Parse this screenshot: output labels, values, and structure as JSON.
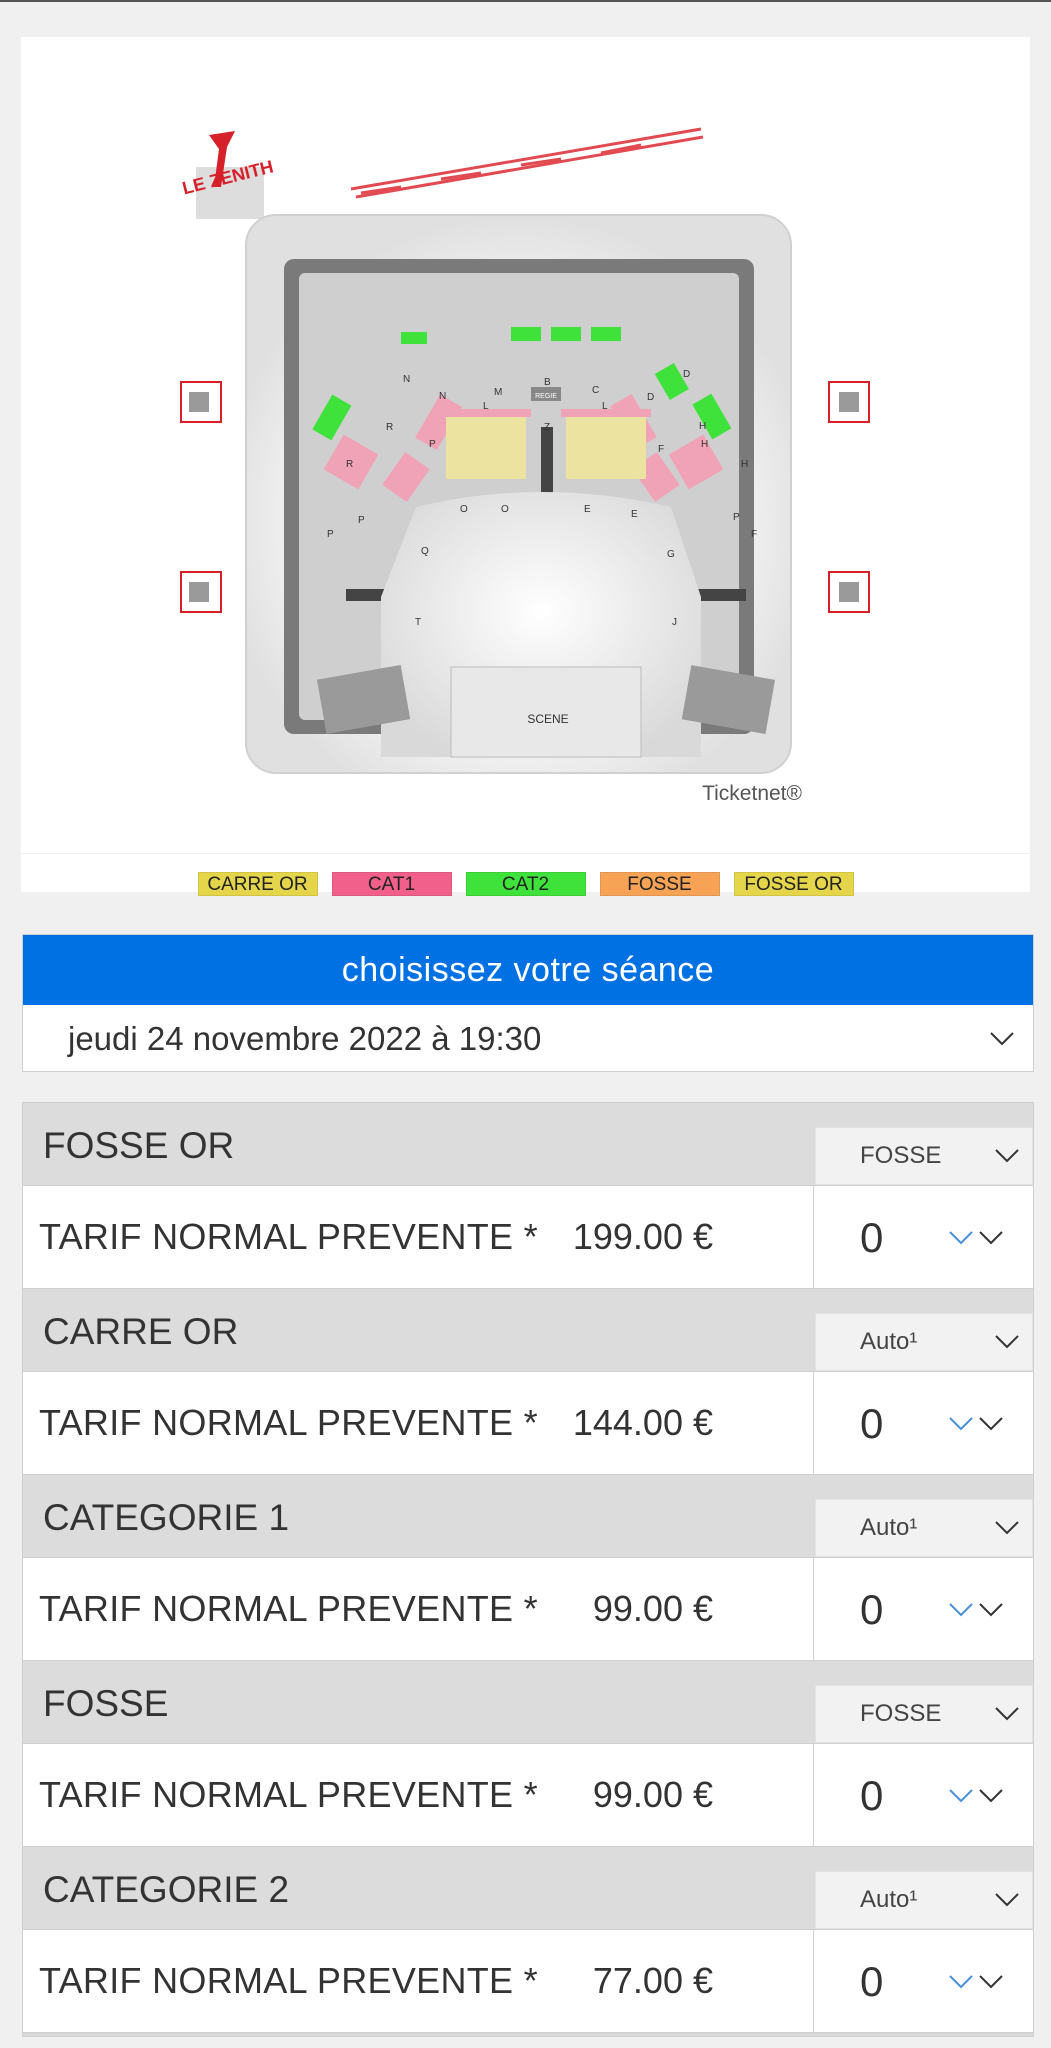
{
  "seat_map": {
    "brand": "LE ZENITH",
    "stage_label": "SCENE",
    "regie_label": "REGIE",
    "provider": "Ticketnet®",
    "row_letters": [
      "N",
      "N",
      "M",
      "L",
      "B",
      "C",
      "D",
      "D",
      "R",
      "P",
      "Z",
      "F",
      "H",
      "R",
      "P",
      "P",
      "O",
      "E",
      "E",
      "G",
      "F",
      "P",
      "Q",
      "T",
      "J",
      "O",
      "L",
      "H",
      "H"
    ]
  },
  "legend": [
    {
      "label": "CARRE OR",
      "color": "#e4d54a"
    },
    {
      "label": "CAT1",
      "color": "#f0608a"
    },
    {
      "label": "CAT2",
      "color": "#3fe23a"
    },
    {
      "label": "FOSSE",
      "color": "#f7a356"
    },
    {
      "label": "FOSSE OR",
      "color": "#e4d54a"
    }
  ],
  "session": {
    "header": "choisissez votre séance",
    "selected": "jeudi 24 novembre 2022 à 19:30"
  },
  "categories": [
    {
      "name": "FOSSE OR",
      "zone": "FOSSE",
      "tarif": "TARIF NORMAL PREVENTE *",
      "price": "199.00 €",
      "qty": "0"
    },
    {
      "name": "CARRE OR",
      "zone": "Auto¹",
      "tarif": "TARIF NORMAL PREVENTE *",
      "price": "144.00 €",
      "qty": "0"
    },
    {
      "name": "CATEGORIE 1",
      "zone": "Auto¹",
      "tarif": "TARIF NORMAL PREVENTE *",
      "price": "99.00 €",
      "qty": "0"
    },
    {
      "name": "FOSSE",
      "zone": "FOSSE",
      "tarif": "TARIF NORMAL PREVENTE *",
      "price": "99.00 €",
      "qty": "0"
    },
    {
      "name": "CATEGORIE 2",
      "zone": "Auto¹",
      "tarif": "TARIF NORMAL PREVENTE *",
      "price": "77.00 €",
      "qty": "0"
    }
  ],
  "colors": {
    "accent": "#0071e3",
    "chevron_blue": "#4a90d9"
  }
}
